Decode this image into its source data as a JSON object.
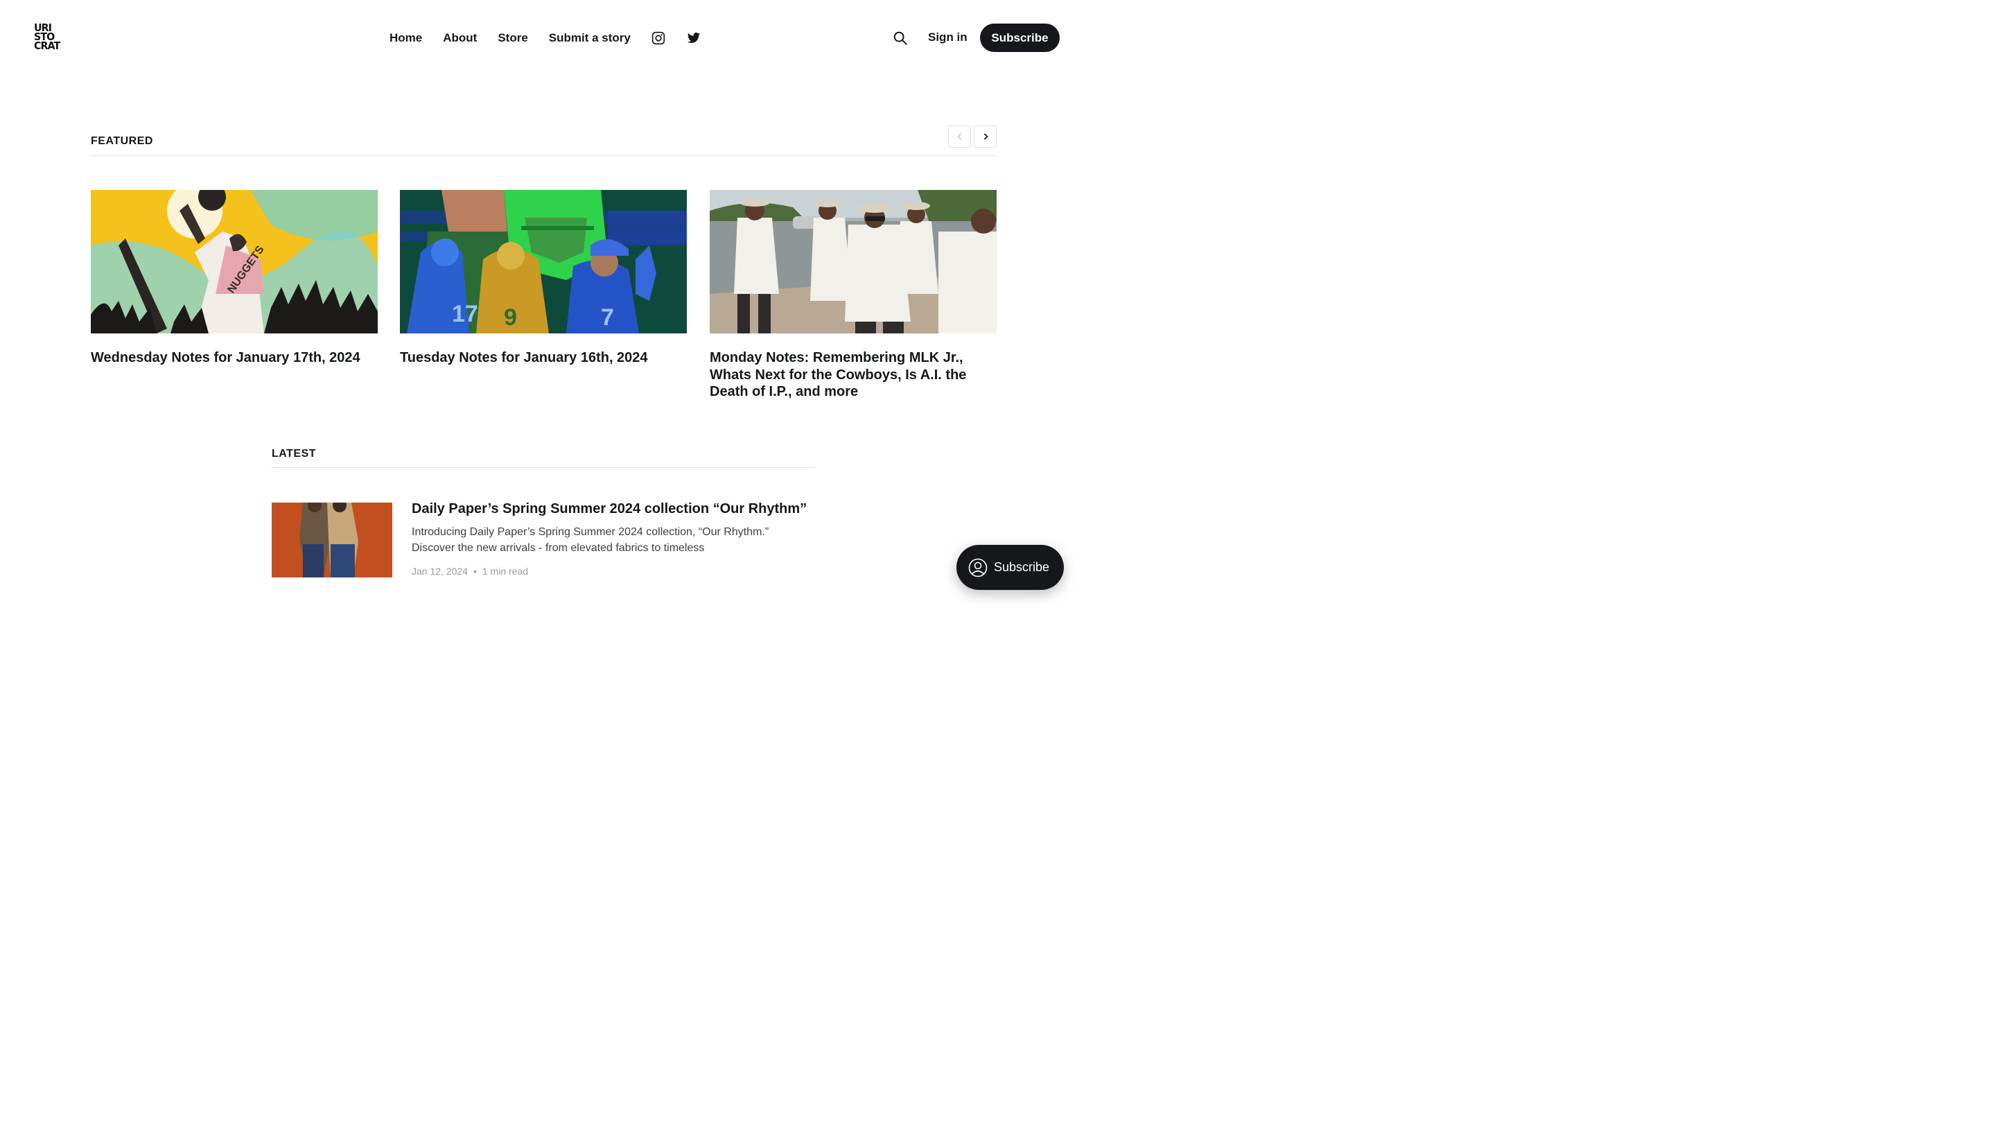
{
  "brand": {
    "logo_lines": [
      "URI",
      "STO",
      "CRAT"
    ]
  },
  "nav": {
    "items": [
      {
        "label": "Home"
      },
      {
        "label": "About"
      },
      {
        "label": "Store"
      },
      {
        "label": "Submit a story"
      }
    ],
    "social": [
      "instagram-icon",
      "twitter-icon"
    ]
  },
  "header": {
    "sign_in": "Sign in",
    "subscribe": "Subscribe"
  },
  "featured": {
    "heading": "FEATURED",
    "cards": [
      {
        "title": "Wednesday Notes for January 17th, 2024",
        "image": "basketball-illustration"
      },
      {
        "title": "Tuesday Notes for January 16th, 2024",
        "image": "football-players-illustration"
      },
      {
        "title": "Monday Notes: Remembering MLK Jr., Whats Next for the Cowboys, Is A.I. the Death of I.P., and more",
        "image": "civil-rights-march-photo"
      }
    ]
  },
  "latest": {
    "heading": "LATEST",
    "posts": [
      {
        "title": "Daily Paper’s Spring Summer 2024 collection “Our Rhythm”",
        "excerpt": "Introducing Daily Paper’s Spring Summer 2024 collection, “Our Rhythm.” Discover the new arrivals - from elevated fabrics to timeless",
        "date": "Jan 12, 2024",
        "read_time": "1 min read"
      }
    ]
  },
  "floating": {
    "subscribe": "Subscribe"
  },
  "colors": {
    "text": "#15171a",
    "button_bg": "#15171a",
    "muted": "#979aa0",
    "rule": "#e5e5e5"
  }
}
